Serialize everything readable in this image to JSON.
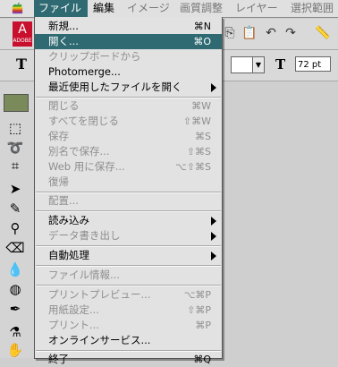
{
  "menubar": {
    "items": [
      {
        "label": "ファイル",
        "active": true
      },
      {
        "label": "編集"
      },
      {
        "label": "イメージ"
      },
      {
        "label": "画質調整"
      },
      {
        "label": "レイヤー"
      },
      {
        "label": "選択範囲"
      }
    ]
  },
  "file_menu": {
    "items": [
      {
        "label": "新規...",
        "shortcut": "⌘N"
      },
      {
        "label": "開く...",
        "shortcut": "⌘O"
      },
      {
        "label": "クリップボードから"
      },
      {
        "label": "Photomerge..."
      },
      {
        "label": "最近使用したファイルを開く"
      },
      {
        "label": "閉じる",
        "shortcut": "⌘W"
      },
      {
        "label": "すべてを閉じる",
        "shortcut": "⇧⌘W"
      },
      {
        "label": "保存",
        "shortcut": "⌘S"
      },
      {
        "label": "別名で保存...",
        "shortcut": "⇧⌘S"
      },
      {
        "label": "Web 用に保存...",
        "shortcut": "⌥⇧⌘S"
      },
      {
        "label": "復帰"
      },
      {
        "label": "配置..."
      },
      {
        "label": "読み込み"
      },
      {
        "label": "データ書き出し"
      },
      {
        "label": "自動処理"
      },
      {
        "label": "ファイル情報..."
      },
      {
        "label": "プリントプレビュー...",
        "shortcut": "⌥⌘P"
      },
      {
        "label": "用紙設定...",
        "shortcut": "⇧⌘P"
      },
      {
        "label": "プリント...",
        "shortcut": "⌘P"
      },
      {
        "label": "オンラインサービス..."
      },
      {
        "label": "終了",
        "shortcut": "⌘Q"
      }
    ]
  },
  "options_bar": {
    "logo": "ADOBE",
    "text_tool_icon": "T",
    "font_size_icon": "T",
    "font_size_value": "72 pt"
  },
  "colors": {
    "highlight": "#2f6a72",
    "menu_bg": "#e2e2e2",
    "disabled_text": "#8e8e8e"
  }
}
